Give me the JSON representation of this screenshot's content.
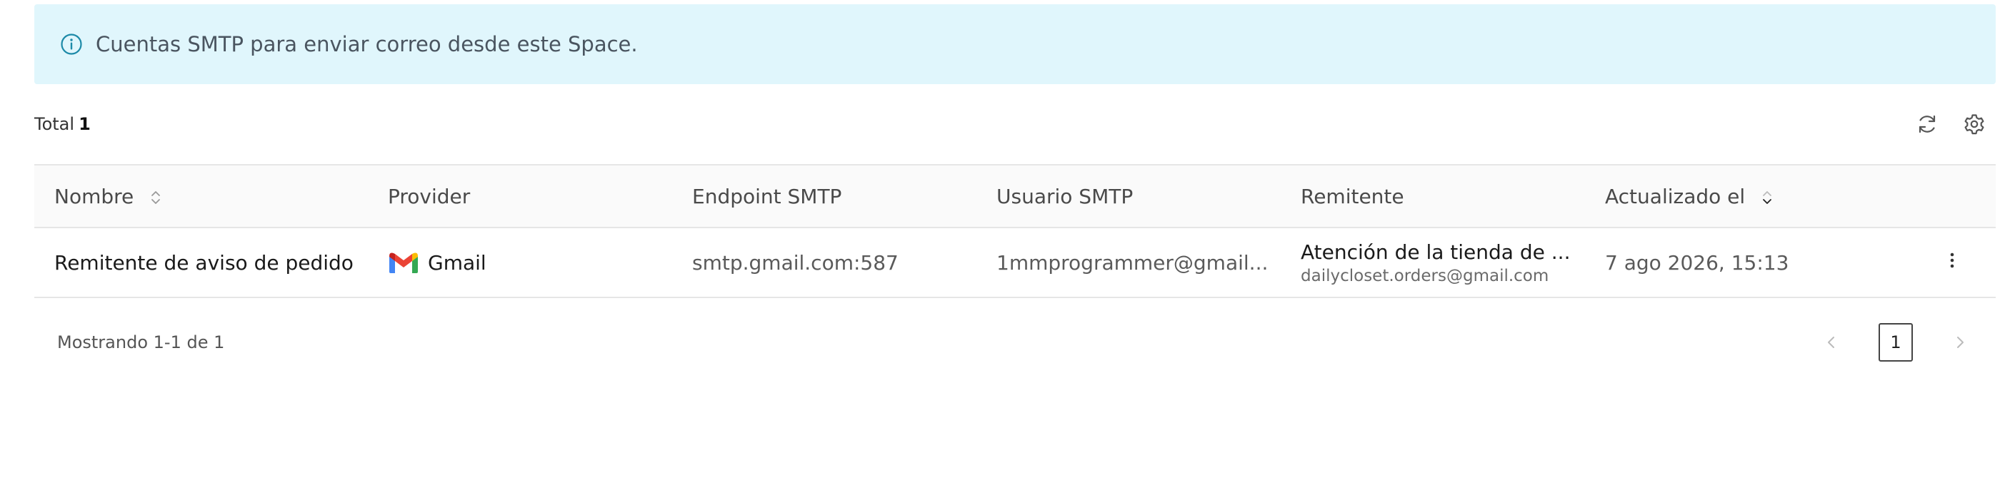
{
  "banner": {
    "icon": "info-icon",
    "text": "Cuentas SMTP para enviar correo desde este Space."
  },
  "toolbar": {
    "total_label": "Total",
    "total_count": "1",
    "refresh_icon": "refresh-icon",
    "settings_icon": "gear-icon"
  },
  "table": {
    "columns": {
      "name": "Nombre",
      "provider": "Provider",
      "endpoint": "Endpoint SMTP",
      "user": "Usuario SMTP",
      "sender": "Remitente",
      "updated": "Actualizado el"
    },
    "rows": [
      {
        "name": "Remitente de aviso de pedido",
        "provider": "Gmail",
        "provider_icon": "gmail-icon",
        "endpoint": "smtp.gmail.com:587",
        "user": "1mmprogrammer@gmail...",
        "sender_name": "Atención de la tienda de ...",
        "sender_email": "dailycloset.orders@gmail.com",
        "updated": "7 ago 2026, 15:13",
        "actions_icon": "more-vertical-icon"
      }
    ]
  },
  "footer": {
    "showing": "Mostrando 1-1 de 1",
    "current_page": "1"
  },
  "colors": {
    "banner_bg": "#e0f6fc",
    "banner_icon": "#1d8aa8",
    "header_bg": "#fafafa",
    "border": "#e6e6e6"
  }
}
